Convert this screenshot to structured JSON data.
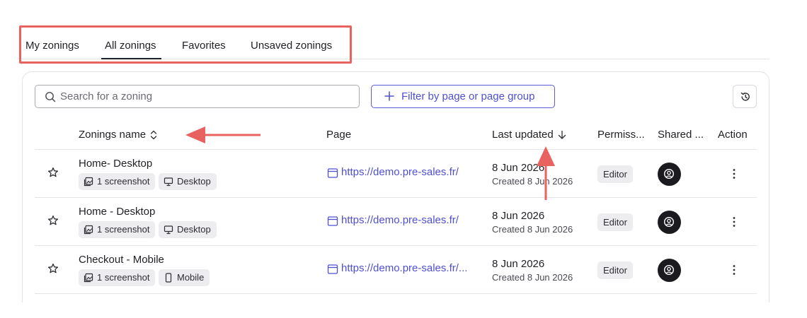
{
  "tabs": [
    {
      "label": "My zonings"
    },
    {
      "label": "All zonings",
      "active": true
    },
    {
      "label": "Favorites"
    },
    {
      "label": "Unsaved zonings"
    }
  ],
  "search": {
    "placeholder": "Search for a zoning",
    "value": ""
  },
  "filter_button": {
    "label": "Filter by page or page group",
    "icon": "plus-icon"
  },
  "history_button": {
    "icon": "history-icon"
  },
  "table": {
    "headers": {
      "name": "Zonings name",
      "page": "Page",
      "last_updated": "Last updated",
      "permissions": "Permiss...",
      "shared": "Shared ...",
      "action": "Action"
    },
    "rows": [
      {
        "name": "Home- Desktop",
        "screenshot_chip": "1 screenshot",
        "device_chip": "Desktop",
        "device_icon": "desktop-icon",
        "page": "https://demo.pre-sales.fr/",
        "updated": "8 Jun 2026",
        "created": "Created 8 Jun 2026",
        "permission": "Editor"
      },
      {
        "name": "Home - Desktop",
        "screenshot_chip": "1 screenshot",
        "device_chip": "Desktop",
        "device_icon": "desktop-icon",
        "page": "https://demo.pre-sales.fr/",
        "updated": "8 Jun 2026",
        "created": "Created 8 Jun 2026",
        "permission": "Editor"
      },
      {
        "name": "Checkout - Mobile",
        "screenshot_chip": "1 screenshot",
        "device_chip": "Mobile",
        "device_icon": "mobile-icon",
        "page": "https://demo.pre-sales.fr/...",
        "updated": "8 Jun 2026",
        "created": "Created 8 Jun 2026",
        "permission": "Editor"
      }
    ]
  },
  "colors": {
    "accent": "#4f4fd0",
    "annotation": "#e8625f",
    "avatar": "#1b1b1f",
    "chip_bg": "#ededf0"
  }
}
